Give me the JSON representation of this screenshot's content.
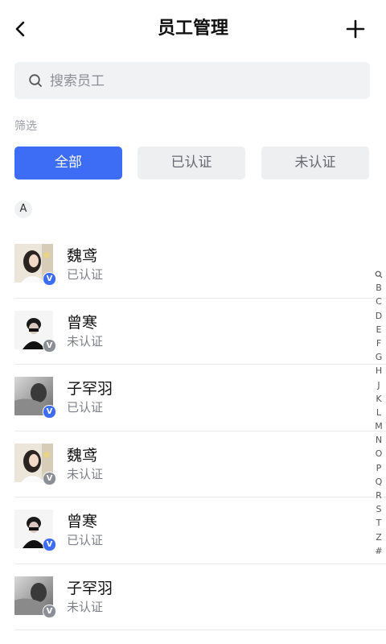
{
  "header": {
    "title": "员工管理",
    "back_icon": "chevron-left-icon",
    "add_icon": "plus-icon"
  },
  "search": {
    "placeholder": "搜索员工",
    "value": "",
    "icon": "search-icon"
  },
  "filter": {
    "label": "筛选",
    "chips": [
      {
        "label": "全部",
        "active": true
      },
      {
        "label": "已认证",
        "active": false
      },
      {
        "label": "未认证",
        "active": false
      }
    ]
  },
  "section": {
    "letter": "A"
  },
  "employees": [
    {
      "name": "魏鸢",
      "status": "已认证",
      "verified": true,
      "avatar": "woman-portrait"
    },
    {
      "name": "曾寒",
      "status": "未认证",
      "verified": false,
      "avatar": "man-portrait"
    },
    {
      "name": "子罕羽",
      "status": "已认证",
      "verified": true,
      "avatar": "grayscale-portrait"
    },
    {
      "name": "魏鸢",
      "status": "未认证",
      "verified": false,
      "avatar": "woman-portrait"
    },
    {
      "name": "曾寒",
      "status": "已认证",
      "verified": true,
      "avatar": "man-portrait"
    },
    {
      "name": "子罕羽",
      "status": "未认证",
      "verified": false,
      "avatar": "grayscale-portrait"
    }
  ],
  "badge_text": "V",
  "index_bar": {
    "search_icon": "search-icon",
    "letters": [
      "B",
      "C",
      "D",
      "E",
      "F",
      "G",
      "H",
      "J",
      "K",
      "L",
      "M",
      "N",
      "O",
      "P",
      "Q",
      "R",
      "S",
      "T",
      "Z",
      "#"
    ]
  },
  "colors": {
    "accent": "#3d6cf5",
    "chip_bg": "#eeeff1",
    "search_bg": "#f1f2f4",
    "unverified_badge": "#8c8f95"
  }
}
